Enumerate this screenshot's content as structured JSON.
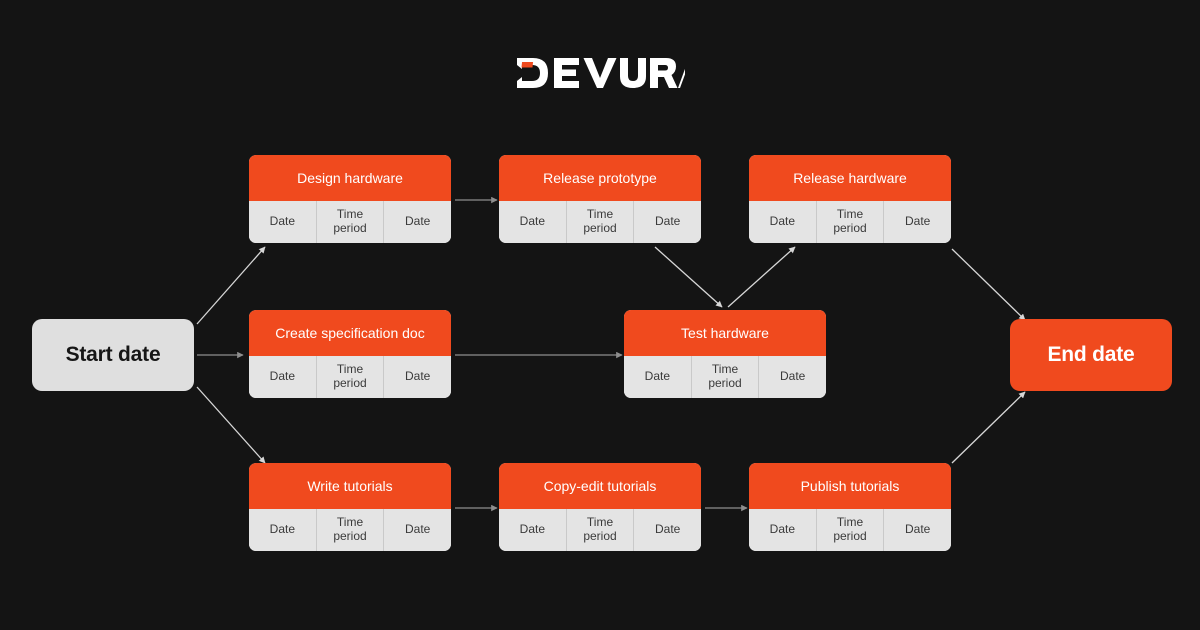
{
  "brand": {
    "name": "DEVURAI",
    "accent_color": "#f04a1e",
    "text_color": "#ffffff"
  },
  "diagram": {
    "type": "flowchart",
    "background_color": "#141414",
    "start_node": {
      "label": "Start date"
    },
    "end_node": {
      "label": "End date"
    },
    "field_labels": {
      "start_date": "Date",
      "duration": "Time period",
      "end_date": "Date"
    },
    "tasks": [
      {
        "id": "design-hardware",
        "label": "Design hardware",
        "fields": [
          "Date",
          "Time period",
          "Date"
        ]
      },
      {
        "id": "release-prototype",
        "label": "Release prototype",
        "fields": [
          "Date",
          "Time period",
          "Date"
        ]
      },
      {
        "id": "release-hardware",
        "label": "Release hardware",
        "fields": [
          "Date",
          "Time period",
          "Date"
        ]
      },
      {
        "id": "create-specification",
        "label": "Create specification doc",
        "fields": [
          "Date",
          "Time period",
          "Date"
        ]
      },
      {
        "id": "test-hardware",
        "label": "Test hardware",
        "fields": [
          "Date",
          "Time period",
          "Date"
        ]
      },
      {
        "id": "write-tutorials",
        "label": "Write tutorials",
        "fields": [
          "Date",
          "Time period",
          "Date"
        ]
      },
      {
        "id": "copy-edit-tutorials",
        "label": "Copy-edit tutorials",
        "fields": [
          "Date",
          "Time period",
          "Date"
        ]
      },
      {
        "id": "publish-tutorials",
        "label": "Publish tutorials",
        "fields": [
          "Date",
          "Time period",
          "Date"
        ]
      }
    ],
    "connections": [
      {
        "from": "start-date",
        "to": "design-hardware"
      },
      {
        "from": "start-date",
        "to": "create-specification"
      },
      {
        "from": "start-date",
        "to": "write-tutorials"
      },
      {
        "from": "design-hardware",
        "to": "release-prototype"
      },
      {
        "from": "release-prototype",
        "to": "test-hardware"
      },
      {
        "from": "create-specification",
        "to": "test-hardware"
      },
      {
        "from": "test-hardware",
        "to": "release-hardware"
      },
      {
        "from": "release-hardware",
        "to": "end-date"
      },
      {
        "from": "write-tutorials",
        "to": "copy-edit-tutorials"
      },
      {
        "from": "copy-edit-tutorials",
        "to": "publish-tutorials"
      },
      {
        "from": "publish-tutorials",
        "to": "end-date"
      }
    ]
  }
}
